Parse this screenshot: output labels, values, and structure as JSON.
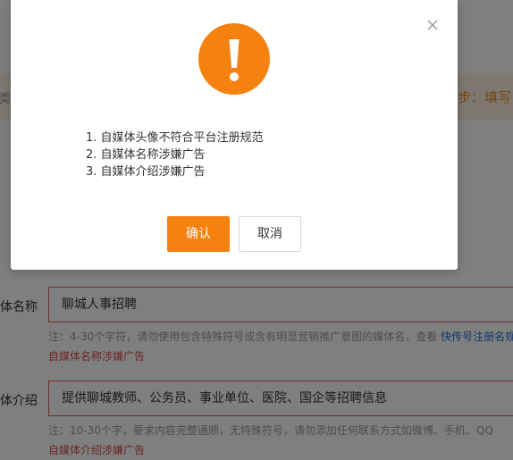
{
  "background": {
    "step_left": "类",
    "step_right": "一步：填写",
    "name_row": {
      "label": "体名称",
      "value": "聊城人事招聘",
      "note_prefix": "注：4-30个字符，请勿使用包含特殊符号或含有明显营销推广意图的媒体名，查看 ",
      "note_link": "快传号注册名规",
      "error": "自媒体名称涉嫌广告"
    },
    "intro_row": {
      "label": "体介绍",
      "value": "提供聊城教师、公务员、事业单位、医院、国企等招聘信息",
      "note": "注：10-30个字，要求内容完整通顺，无特殊符号，请勿添加任何联系方式如微博、手机、QQ",
      "error": "自媒体介绍涉嫌广告"
    }
  },
  "dialog": {
    "reasons": [
      "1. 自媒体头像不符合平台注册规范",
      "2. 自媒体名称涉嫌广告",
      "3. 自媒体介绍涉嫌广告"
    ],
    "confirm_label": "确认",
    "cancel_label": "取消"
  },
  "colors": {
    "accent": "#f5820f",
    "error": "#d84a4a",
    "link": "#1e6fd9",
    "overlay": "rgba(0,0,0,0.5)"
  },
  "icons": {
    "close": "close-icon",
    "warning": "exclamation-warning-icon"
  }
}
